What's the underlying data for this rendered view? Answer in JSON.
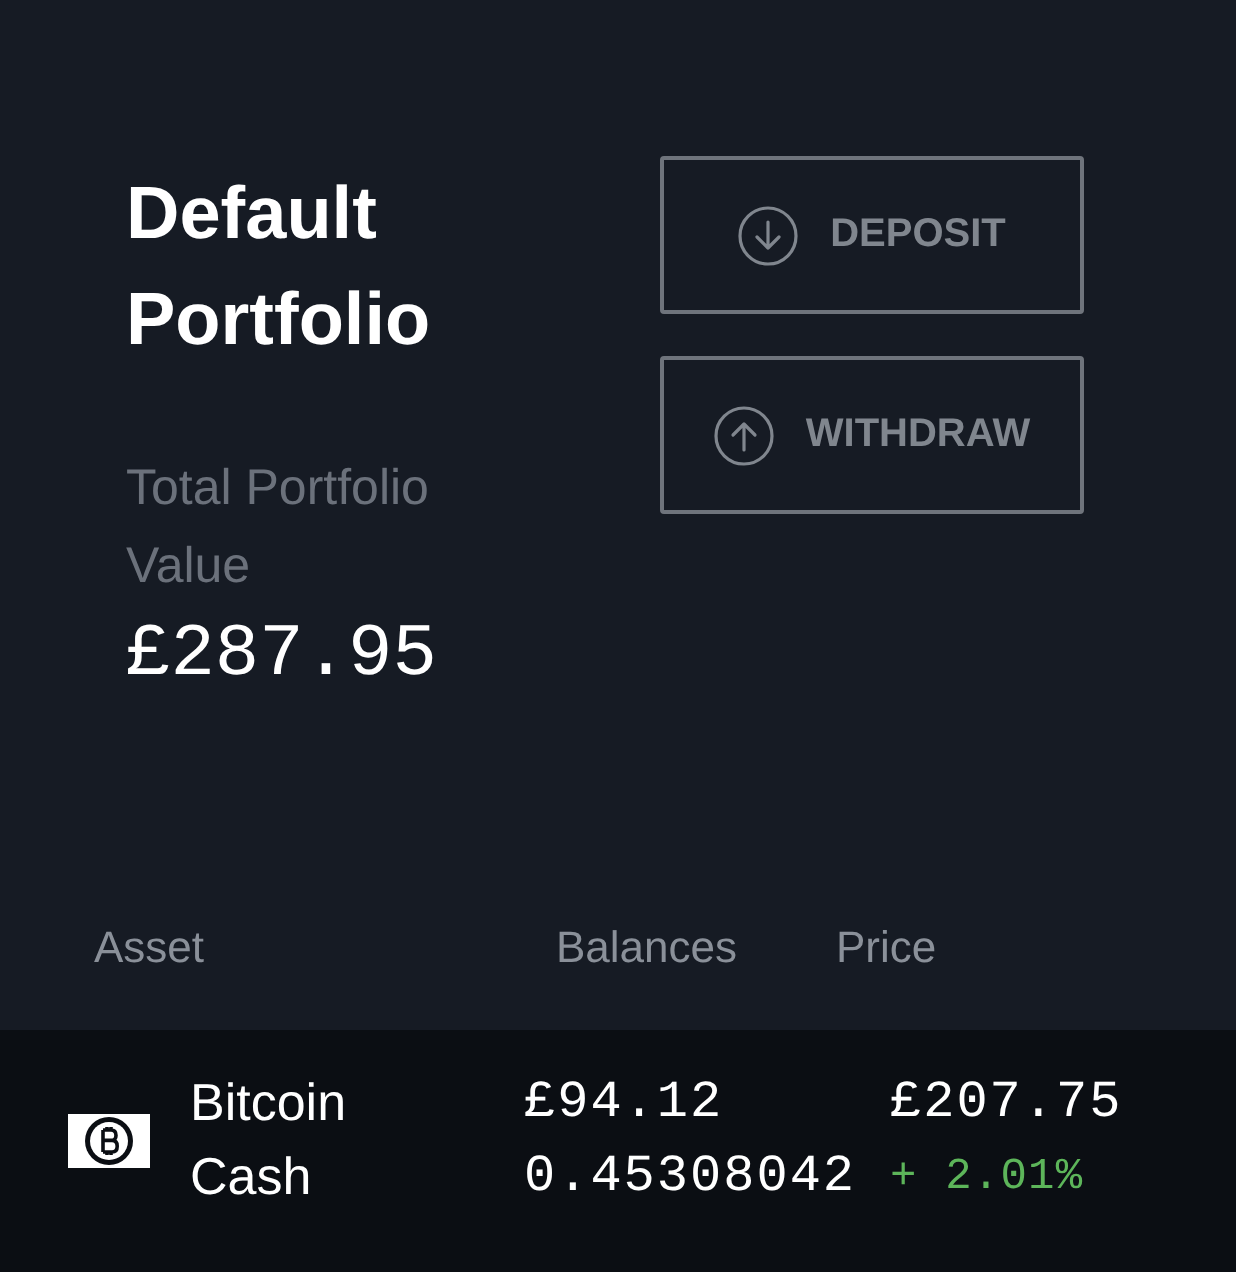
{
  "portfolio": {
    "title": "Default Portfolio",
    "value_label": "Total Portfolio Value",
    "value": "£287.95"
  },
  "actions": [
    {
      "kind": "deposit",
      "label": "DEPOSIT"
    },
    {
      "kind": "withdraw",
      "label": "WITHDRAW"
    }
  ],
  "table": {
    "columns": [
      "Asset",
      "Balances",
      "Price"
    ],
    "rows": [
      {
        "name": "Bitcoin Cash",
        "balance_fiat": "£94.12",
        "balance_crypto": "0.45308042",
        "price": "£207.75",
        "change": "+ 2.01%",
        "positive": true
      }
    ]
  }
}
